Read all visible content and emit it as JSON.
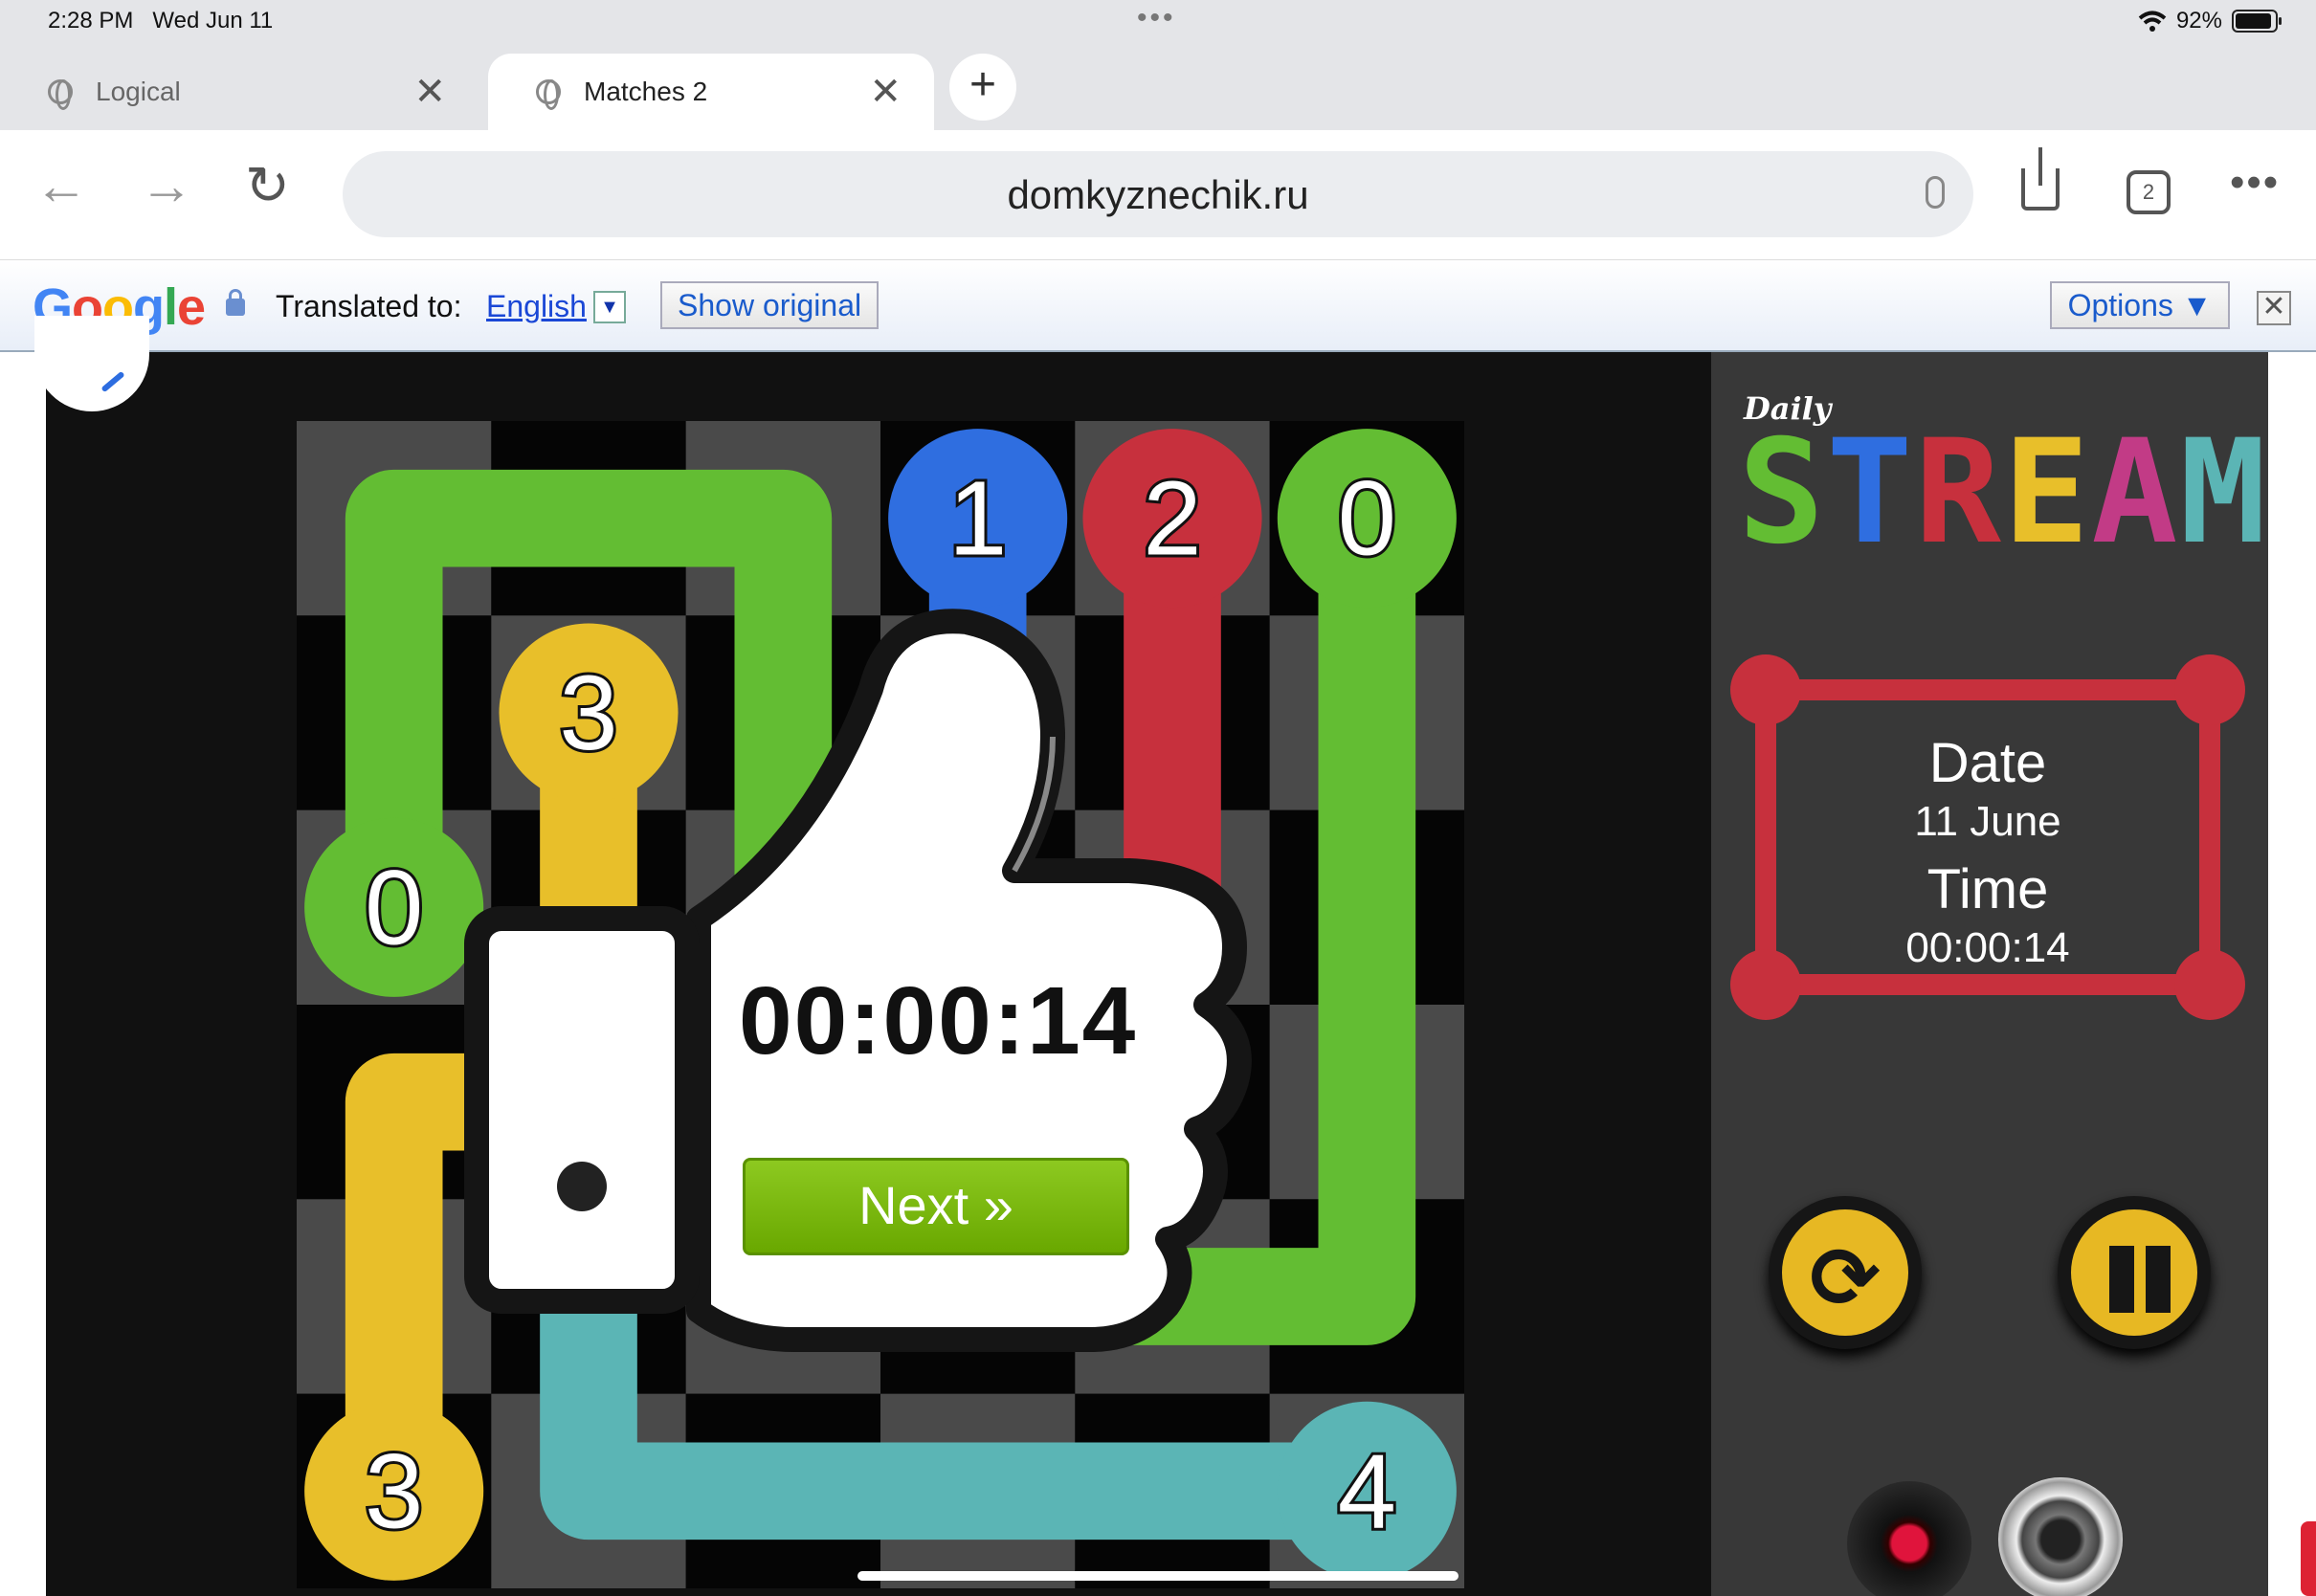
{
  "status_bar": {
    "time": "2:28 PM",
    "date": "Wed Jun 11",
    "battery": "92%",
    "battery_level": 0.92
  },
  "tabs": [
    {
      "label": "Logical",
      "active": false
    },
    {
      "label": "Matches 2",
      "active": true
    }
  ],
  "toolbar": {
    "url": "domkyznechik.ru",
    "tab_count": "2"
  },
  "translate_bar": {
    "logo": "Google",
    "label": "Translated to:",
    "language": "English",
    "show_original": "Show original",
    "options": "Options ▼",
    "close": "✕"
  },
  "game": {
    "logo_small": "Daily",
    "logo_big": "STREAM",
    "info": {
      "date_label": "Date",
      "date_value": "11 June",
      "time_label": "Time",
      "time_value": "00:00:14"
    },
    "overlay": {
      "time": "00:00:14",
      "next_label": "Next »"
    },
    "grid_size": 6,
    "colors": {
      "green": "#63bd33",
      "yellow": "#e8bf2a",
      "red": "#c7303d",
      "blue": "#2f6ee0",
      "teal": "#5bb5b5"
    },
    "nodes": [
      {
        "row": 0,
        "col": 3,
        "label": "1",
        "color": "blue"
      },
      {
        "row": 0,
        "col": 4,
        "label": "2",
        "color": "red"
      },
      {
        "row": 0,
        "col": 5,
        "label": "0",
        "color": "green"
      },
      {
        "row": 1,
        "col": 1,
        "label": "3",
        "color": "yellow"
      },
      {
        "row": 2,
        "col": 0,
        "label": "0",
        "color": "green"
      },
      {
        "row": 5,
        "col": 0,
        "label": "3",
        "color": "yellow"
      },
      {
        "row": 5,
        "col": 5,
        "label": "4",
        "color": "teal"
      }
    ],
    "paths": [
      {
        "color": "green",
        "cells": [
          [
            2,
            0
          ],
          [
            0,
            0
          ],
          [
            0,
            2
          ],
          [
            4,
            2
          ]
        ]
      },
      {
        "color": "green",
        "cells": [
          [
            0,
            5
          ],
          [
            4,
            5
          ],
          [
            4,
            3
          ]
        ]
      },
      {
        "color": "red",
        "cells": [
          [
            0,
            4
          ],
          [
            3,
            4
          ]
        ]
      },
      {
        "color": "blue",
        "cells": [
          [
            0,
            3
          ],
          [
            1,
            3
          ]
        ]
      },
      {
        "color": "yellow",
        "cells": [
          [
            1,
            1
          ],
          [
            2,
            1
          ]
        ]
      },
      {
        "color": "yellow",
        "cells": [
          [
            5,
            0
          ],
          [
            3,
            0
          ],
          [
            3,
            1
          ]
        ]
      },
      {
        "color": "teal",
        "cells": [
          [
            5,
            5
          ],
          [
            5,
            1
          ],
          [
            4,
            1
          ]
        ]
      }
    ]
  }
}
